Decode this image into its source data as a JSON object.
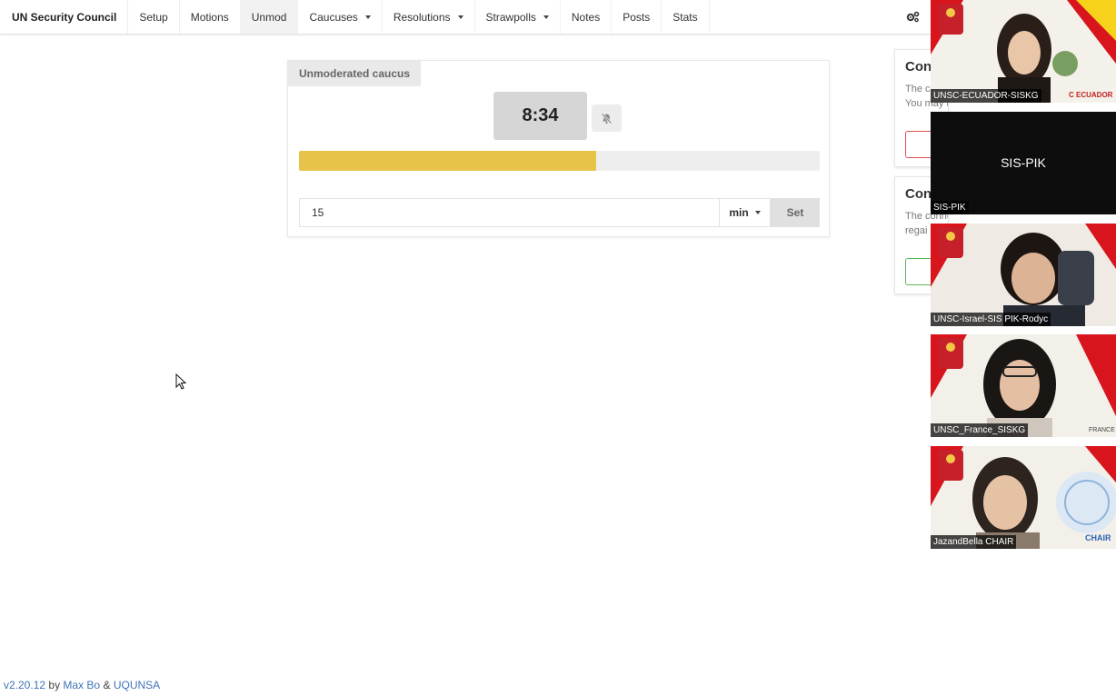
{
  "navbar": {
    "brand": "UN Security Council",
    "items": [
      {
        "label": "Setup",
        "dropdown": false,
        "active": false
      },
      {
        "label": "Motions",
        "dropdown": false,
        "active": false
      },
      {
        "label": "Unmod",
        "dropdown": false,
        "active": true
      },
      {
        "label": "Caucuses",
        "dropdown": true,
        "active": false
      },
      {
        "label": "Resolutions",
        "dropdown": true,
        "active": false
      },
      {
        "label": "Strawpolls",
        "dropdown": true,
        "active": false
      },
      {
        "label": "Notes",
        "dropdown": false,
        "active": false
      },
      {
        "label": "Posts",
        "dropdown": false,
        "active": false
      },
      {
        "label": "Stats",
        "dropdown": false,
        "active": false
      }
    ],
    "settings_icon": "cogs-icon"
  },
  "unmod": {
    "label": "Unmoderated caucus",
    "timer": "8:34",
    "mute_icon": "bell-slash-icon",
    "progress_fraction": 0.571,
    "progress_color": "#e8c34a",
    "duration_value": "15",
    "duration_unit": "min",
    "set_label": "Set"
  },
  "notifications": [
    {
      "title": "Con",
      "lines": [
        "The c",
        "You may have been logged out"
      ],
      "accent": "#e05050"
    },
    {
      "title": "Con",
      "lines": [
        "The connection to the server was",
        "regai"
      ],
      "accent": "#5cb85c"
    }
  ],
  "participants": [
    {
      "name": "UNSC-ECUADOR-SISKG",
      "overlay": "C ECUADOR",
      "video": true
    },
    {
      "name": "SIS-PIK",
      "center_name": "SIS-PIK",
      "video": false
    },
    {
      "name": "UNSC-Israel-SIS PIK-Rodyc",
      "video": true
    },
    {
      "name": "UNSC_France_SISKG",
      "overlay": "FRANCE",
      "video": true
    },
    {
      "name": "JazandBella CHAIR",
      "overlay": "CHAIR",
      "video": true
    }
  ],
  "footer": {
    "version": "v2.20.12",
    "by": "by",
    "author": "Max Bo",
    "amp": "&",
    "org": "UQUNSA"
  }
}
